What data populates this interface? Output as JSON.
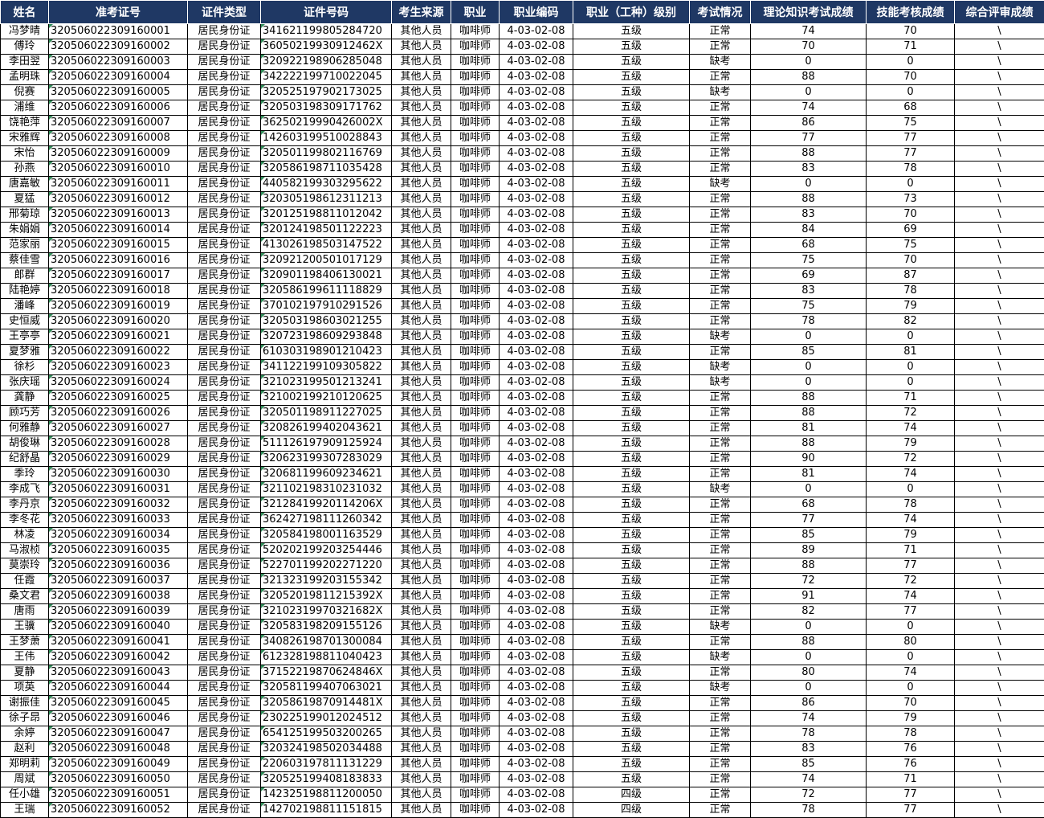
{
  "headers": [
    "姓名",
    "准考证号",
    "证件类型",
    "证件号码",
    "考生来源",
    "职业",
    "职业编码",
    "职业（工种）级别",
    "考试情况",
    "理论知识考试成绩",
    "技能考核成绩",
    "综合评审成绩"
  ],
  "rows": [
    [
      "冯梦晴",
      "320506022309160001",
      "居民身份证",
      "341621199805284720",
      "其他人员",
      "咖啡师",
      "4-03-02-08",
      "五级",
      "正常",
      "74",
      "70",
      "\\"
    ],
    [
      "傅玲",
      "320506022309160002",
      "居民身份证",
      "36050219930912462X",
      "其他人员",
      "咖啡师",
      "4-03-02-08",
      "五级",
      "正常",
      "70",
      "71",
      "\\"
    ],
    [
      "李田翌",
      "320506022309160003",
      "居民身份证",
      "320922198906285048",
      "其他人员",
      "咖啡师",
      "4-03-02-08",
      "五级",
      "缺考",
      "0",
      "0",
      "\\"
    ],
    [
      "孟明珠",
      "320506022309160004",
      "居民身份证",
      "342222199710022045",
      "其他人员",
      "咖啡师",
      "4-03-02-08",
      "五级",
      "正常",
      "88",
      "70",
      "\\"
    ],
    [
      "倪赛",
      "320506022309160005",
      "居民身份证",
      "320525197902173025",
      "其他人员",
      "咖啡师",
      "4-03-02-08",
      "五级",
      "缺考",
      "0",
      "0",
      "\\"
    ],
    [
      "浦维",
      "320506022309160006",
      "居民身份证",
      "320503198309171762",
      "其他人员",
      "咖啡师",
      "4-03-02-08",
      "五级",
      "正常",
      "74",
      "68",
      "\\"
    ],
    [
      "饶艳萍",
      "320506022309160007",
      "居民身份证",
      "36250219990426002X",
      "其他人员",
      "咖啡师",
      "4-03-02-08",
      "五级",
      "正常",
      "86",
      "75",
      "\\"
    ],
    [
      "宋雅辉",
      "320506022309160008",
      "居民身份证",
      "142603199510028843",
      "其他人员",
      "咖啡师",
      "4-03-02-08",
      "五级",
      "正常",
      "77",
      "77",
      "\\"
    ],
    [
      "宋怡",
      "320506022309160009",
      "居民身份证",
      "320501199802116769",
      "其他人员",
      "咖啡师",
      "4-03-02-08",
      "五级",
      "正常",
      "88",
      "77",
      "\\"
    ],
    [
      "孙燕",
      "320506022309160010",
      "居民身份证",
      "320586198711035428",
      "其他人员",
      "咖啡师",
      "4-03-02-08",
      "五级",
      "正常",
      "83",
      "78",
      "\\"
    ],
    [
      "唐嘉敏",
      "320506022309160011",
      "居民身份证",
      "440582199303295622",
      "其他人员",
      "咖啡师",
      "4-03-02-08",
      "五级",
      "缺考",
      "0",
      "0",
      "\\"
    ],
    [
      "夏猛",
      "320506022309160012",
      "居民身份证",
      "320305198612311213",
      "其他人员",
      "咖啡师",
      "4-03-02-08",
      "五级",
      "正常",
      "88",
      "73",
      "\\"
    ],
    [
      "邢菊琼",
      "320506022309160013",
      "居民身份证",
      "320125198811012042",
      "其他人员",
      "咖啡师",
      "4-03-02-08",
      "五级",
      "正常",
      "83",
      "70",
      "\\"
    ],
    [
      "朱娟娟",
      "320506022309160014",
      "居民身份证",
      "320124198501122223",
      "其他人员",
      "咖啡师",
      "4-03-02-08",
      "五级",
      "正常",
      "84",
      "69",
      "\\"
    ],
    [
      "范家丽",
      "320506022309160015",
      "居民身份证",
      "413026198503147522",
      "其他人员",
      "咖啡师",
      "4-03-02-08",
      "五级",
      "正常",
      "68",
      "75",
      "\\"
    ],
    [
      "蔡佳雪",
      "320506022309160016",
      "居民身份证",
      "320921200501017129",
      "其他人员",
      "咖啡师",
      "4-03-02-08",
      "五级",
      "正常",
      "75",
      "70",
      "\\"
    ],
    [
      "郎群",
      "320506022309160017",
      "居民身份证",
      "320901198406130021",
      "其他人员",
      "咖啡师",
      "4-03-02-08",
      "五级",
      "正常",
      "69",
      "87",
      "\\"
    ],
    [
      "陆艳婷",
      "320506022309160018",
      "居民身份证",
      "320586199611118829",
      "其他人员",
      "咖啡师",
      "4-03-02-08",
      "五级",
      "正常",
      "83",
      "78",
      "\\"
    ],
    [
      "潘峰",
      "320506022309160019",
      "居民身份证",
      "370102197910291526",
      "其他人员",
      "咖啡师",
      "4-03-02-08",
      "五级",
      "正常",
      "75",
      "79",
      "\\"
    ],
    [
      "史恒威",
      "320506022309160020",
      "居民身份证",
      "320503198603021255",
      "其他人员",
      "咖啡师",
      "4-03-02-08",
      "五级",
      "正常",
      "78",
      "82",
      "\\"
    ],
    [
      "王亭亭",
      "320506022309160021",
      "居民身份证",
      "320723198609293848",
      "其他人员",
      "咖啡师",
      "4-03-02-08",
      "五级",
      "缺考",
      "0",
      "0",
      "\\"
    ],
    [
      "夏梦雅",
      "320506022309160022",
      "居民身份证",
      "610303198901210423",
      "其他人员",
      "咖啡师",
      "4-03-02-08",
      "五级",
      "正常",
      "85",
      "81",
      "\\"
    ],
    [
      "徐杉",
      "320506022309160023",
      "居民身份证",
      "341122199109305822",
      "其他人员",
      "咖啡师",
      "4-03-02-08",
      "五级",
      "缺考",
      "0",
      "0",
      "\\"
    ],
    [
      "张庆瑶",
      "320506022309160024",
      "居民身份证",
      "321023199501213241",
      "其他人员",
      "咖啡师",
      "4-03-02-08",
      "五级",
      "缺考",
      "0",
      "0",
      "\\"
    ],
    [
      "龚静",
      "320506022309160025",
      "居民身份证",
      "321002199210120625",
      "其他人员",
      "咖啡师",
      "4-03-02-08",
      "五级",
      "正常",
      "88",
      "71",
      "\\"
    ],
    [
      "顾巧芳",
      "320506022309160026",
      "居民身份证",
      "320501198911227025",
      "其他人员",
      "咖啡师",
      "4-03-02-08",
      "五级",
      "正常",
      "88",
      "72",
      "\\"
    ],
    [
      "何雅静",
      "320506022309160027",
      "居民身份证",
      "320826199402043621",
      "其他人员",
      "咖啡师",
      "4-03-02-08",
      "五级",
      "正常",
      "81",
      "74",
      "\\"
    ],
    [
      "胡俊琳",
      "320506022309160028",
      "居民身份证",
      "511126197909125924",
      "其他人员",
      "咖啡师",
      "4-03-02-08",
      "五级",
      "正常",
      "88",
      "79",
      "\\"
    ],
    [
      "纪舒晶",
      "320506022309160029",
      "居民身份证",
      "320623199307283029",
      "其他人员",
      "咖啡师",
      "4-03-02-08",
      "五级",
      "正常",
      "90",
      "72",
      "\\"
    ],
    [
      "季玲",
      "320506022309160030",
      "居民身份证",
      "320681199609234621",
      "其他人员",
      "咖啡师",
      "4-03-02-08",
      "五级",
      "正常",
      "81",
      "74",
      "\\"
    ],
    [
      "李成飞",
      "320506022309160031",
      "居民身份证",
      "321102198310231032",
      "其他人员",
      "咖啡师",
      "4-03-02-08",
      "五级",
      "缺考",
      "0",
      "0",
      "\\"
    ],
    [
      "李丹京",
      "320506022309160032",
      "居民身份证",
      "32128419920114206X",
      "其他人员",
      "咖啡师",
      "4-03-02-08",
      "五级",
      "正常",
      "68",
      "78",
      "\\"
    ],
    [
      "李冬花",
      "320506022309160033",
      "居民身份证",
      "362427198111260342",
      "其他人员",
      "咖啡师",
      "4-03-02-08",
      "五级",
      "正常",
      "77",
      "74",
      "\\"
    ],
    [
      "林凌",
      "320506022309160034",
      "居民身份证",
      "320584198001163529",
      "其他人员",
      "咖啡师",
      "4-03-02-08",
      "五级",
      "正常",
      "85",
      "79",
      "\\"
    ],
    [
      "马淑桢",
      "320506022309160035",
      "居民身份证",
      "520202199203254446",
      "其他人员",
      "咖啡师",
      "4-03-02-08",
      "五级",
      "正常",
      "89",
      "71",
      "\\"
    ],
    [
      "莫崇玲",
      "320506022309160036",
      "居民身份证",
      "522701199202271220",
      "其他人员",
      "咖啡师",
      "4-03-02-08",
      "五级",
      "正常",
      "88",
      "77",
      "\\"
    ],
    [
      "任霞",
      "320506022309160037",
      "居民身份证",
      "321323199203155342",
      "其他人员",
      "咖啡师",
      "4-03-02-08",
      "五级",
      "正常",
      "72",
      "72",
      "\\"
    ],
    [
      "桑文君",
      "320506022309160038",
      "居民身份证",
      "32052019811215392X",
      "其他人员",
      "咖啡师",
      "4-03-02-08",
      "五级",
      "正常",
      "91",
      "74",
      "\\"
    ],
    [
      "唐雨",
      "320506022309160039",
      "居民身份证",
      "32102319970321682X",
      "其他人员",
      "咖啡师",
      "4-03-02-08",
      "五级",
      "正常",
      "82",
      "77",
      "\\"
    ],
    [
      "王骥",
      "320506022309160040",
      "居民身份证",
      "320583198209155126",
      "其他人员",
      "咖啡师",
      "4-03-02-08",
      "五级",
      "缺考",
      "0",
      "0",
      "\\"
    ],
    [
      "王梦萧",
      "320506022309160041",
      "居民身份证",
      "340826198701300084",
      "其他人员",
      "咖啡师",
      "4-03-02-08",
      "五级",
      "正常",
      "88",
      "80",
      "\\"
    ],
    [
      "王伟",
      "320506022309160042",
      "居民身份证",
      "612328198811040423",
      "其他人员",
      "咖啡师",
      "4-03-02-08",
      "五级",
      "缺考",
      "0",
      "0",
      "\\"
    ],
    [
      "夏静",
      "320506022309160043",
      "居民身份证",
      "37152219870624846X",
      "其他人员",
      "咖啡师",
      "4-03-02-08",
      "五级",
      "正常",
      "80",
      "74",
      "\\"
    ],
    [
      "项英",
      "320506022309160044",
      "居民身份证",
      "320581199407063021",
      "其他人员",
      "咖啡师",
      "4-03-02-08",
      "五级",
      "缺考",
      "0",
      "0",
      "\\"
    ],
    [
      "谢振佳",
      "320506022309160045",
      "居民身份证",
      "32058619870914481X",
      "其他人员",
      "咖啡师",
      "4-03-02-08",
      "五级",
      "正常",
      "86",
      "70",
      "\\"
    ],
    [
      "徐子昂",
      "320506022309160046",
      "居民身份证",
      "230225199012024512",
      "其他人员",
      "咖啡师",
      "4-03-02-08",
      "五级",
      "正常",
      "74",
      "79",
      "\\"
    ],
    [
      "余婷",
      "320506022309160047",
      "居民身份证",
      "654125199503200265",
      "其他人员",
      "咖啡师",
      "4-03-02-08",
      "五级",
      "正常",
      "78",
      "78",
      "\\"
    ],
    [
      "赵利",
      "320506022309160048",
      "居民身份证",
      "320324198502034488",
      "其他人员",
      "咖啡师",
      "4-03-02-08",
      "五级",
      "正常",
      "83",
      "76",
      "\\"
    ],
    [
      "郑明莉",
      "320506022309160049",
      "居民身份证",
      "220603197811131229",
      "其他人员",
      "咖啡师",
      "4-03-02-08",
      "五级",
      "正常",
      "85",
      "76",
      "\\"
    ],
    [
      "周斌",
      "320506022309160050",
      "居民身份证",
      "320525199408183833",
      "其他人员",
      "咖啡师",
      "4-03-02-08",
      "五级",
      "正常",
      "74",
      "71",
      "\\"
    ],
    [
      "任小雄",
      "320506022309160051",
      "居民身份证",
      "142325198811200050",
      "其他人员",
      "咖啡师",
      "4-03-02-08",
      "四级",
      "正常",
      "72",
      "77",
      "\\"
    ],
    [
      "王瑞",
      "320506022309160052",
      "居民身份证",
      "142702198811151815",
      "其他人员",
      "咖啡师",
      "4-03-02-08",
      "四级",
      "正常",
      "78",
      "77",
      "\\"
    ]
  ]
}
